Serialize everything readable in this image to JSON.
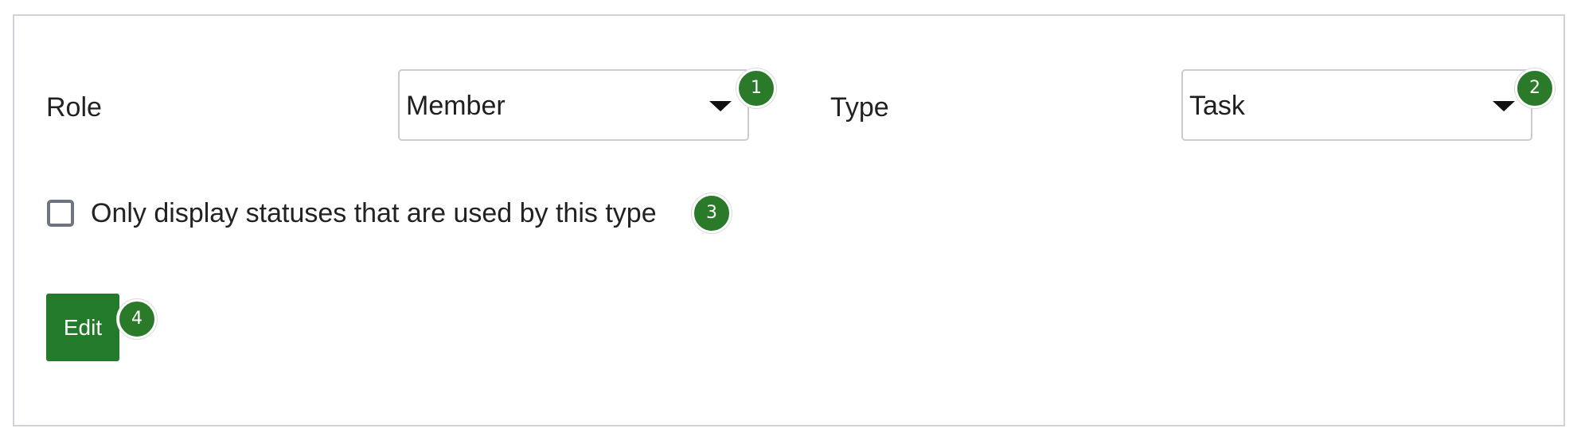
{
  "form": {
    "role_label": "Role",
    "role_value": "Member",
    "type_label": "Type",
    "type_value": "Task",
    "checkbox_label": "Only display statuses that are used by this type",
    "checkbox_checked": false,
    "edit_label": "Edit"
  },
  "badges": [
    "1",
    "2",
    "3",
    "4"
  ],
  "colors": {
    "accent": "#237a2b",
    "badge": "#2a7a2a",
    "border": "#cfd2d6"
  },
  "icons": {
    "select_caret": "caret-down-icon"
  }
}
